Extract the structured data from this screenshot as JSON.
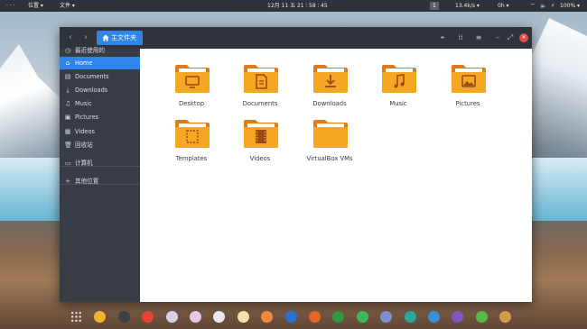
{
  "top_panel": {
    "dots": "· · ·",
    "places_menu": "位置 ▾",
    "file_menu": "文件 ▾",
    "clock": "12月 11 五 21 ∶ 58 ∶ 45",
    "workspace": "1",
    "net_speed": "13.4k/s ▾",
    "status_a": "0h ▾",
    "wifi": "⌔",
    "volume": "🔈",
    "power": "⚡",
    "battery": "100% ▾"
  },
  "window": {
    "path_label": "主文件夹",
    "sidebar": [
      {
        "label": "最近使用的",
        "icon": "clock-icon"
      },
      {
        "label": "Home",
        "icon": "home-icon",
        "active": true
      },
      {
        "label": "Documents",
        "icon": "document-icon"
      },
      {
        "label": "Downloads",
        "icon": "download-icon"
      },
      {
        "label": "Music",
        "icon": "music-icon"
      },
      {
        "label": "Pictures",
        "icon": "picture-icon"
      },
      {
        "label": "Videos",
        "icon": "video-icon"
      },
      {
        "label": "回收站",
        "icon": "trash-icon"
      },
      {
        "label": "计算机",
        "icon": "computer-icon"
      },
      {
        "label": "其他位置",
        "icon": "plus-icon"
      }
    ],
    "folders": [
      {
        "label": "Desktop",
        "emblem": "desktop-icon"
      },
      {
        "label": "Documents",
        "emblem": "document-icon"
      },
      {
        "label": "Downloads",
        "emblem": "download-icon"
      },
      {
        "label": "Music",
        "emblem": "music-icon"
      },
      {
        "label": "Pictures",
        "emblem": "picture-icon"
      },
      {
        "label": "Templates",
        "emblem": "template-icon"
      },
      {
        "label": "Videos",
        "emblem": "video-icon"
      },
      {
        "label": "VirtualBox VMs",
        "emblem": "none"
      }
    ]
  },
  "colors": {
    "accent": "#2f86e8",
    "folder": "#f5a623",
    "folder_tab": "#e07b1d",
    "sidebar_bg": "#383d45",
    "headerbar_bg": "#2f333a",
    "close": "#e24a45"
  },
  "dock": [
    {
      "name": "app-grid-icon",
      "color": "#cfd3d8"
    },
    {
      "name": "files-icon",
      "color": "#f0b32c"
    },
    {
      "name": "terminal-icon",
      "color": "#3b3f46"
    },
    {
      "name": "chrome-icon",
      "color": "#e94235"
    },
    {
      "name": "app-pink-icon",
      "color": "#d9d0e8"
    },
    {
      "name": "app-purple-icon",
      "color": "#e6c7e6"
    },
    {
      "name": "feather-icon",
      "color": "#e6e9ef"
    },
    {
      "name": "drawing-icon",
      "color": "#f6e2a8"
    },
    {
      "name": "app-orange-icon",
      "color": "#f08a3a"
    },
    {
      "name": "word-icon",
      "color": "#2c6fd6"
    },
    {
      "name": "presentation-icon",
      "color": "#e8632a"
    },
    {
      "name": "spreadsheet-icon",
      "color": "#2f9a3d"
    },
    {
      "name": "android-icon",
      "color": "#3cb85a"
    },
    {
      "name": "app-lilac-icon",
      "color": "#7e8fd4"
    },
    {
      "name": "monitor-icon",
      "color": "#2ba7a0"
    },
    {
      "name": "image-viewer-icon",
      "color": "#3a8fd8"
    },
    {
      "name": "media-player-icon",
      "color": "#7d57c2"
    },
    {
      "name": "app-green-icon",
      "color": "#58b947"
    },
    {
      "name": "app-tan-icon",
      "color": "#d69a4a"
    }
  ]
}
